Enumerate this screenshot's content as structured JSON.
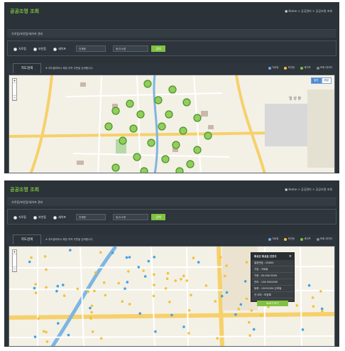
{
  "screen1": {
    "title": "공공조명 조회",
    "breadcrumb": "Home > 공공관리 > 공공조명 조회",
    "section_label": "가로등/보안등/세이프 관리",
    "radios": [
      "가로등",
      "보안등",
      "세이프"
    ],
    "select_value": "전체행",
    "search_placeholder": "동/주소명",
    "search_button": "검색",
    "map_tab": "지도검색",
    "map_hint": "※ 지도클릭하시 해당 지역 주변설 검색합니다.",
    "legend": [
      "가로등",
      "보안등",
      "세이프",
      "조회 데이터"
    ],
    "map_toggle": [
      "일반",
      "위성"
    ],
    "map_place": "일 성 정"
  },
  "screen2": {
    "title": "공공조명 조회",
    "breadcrumb": "Home > 공공관리 > 공공조명 조회",
    "section_label": "가로등/보안등/세이프 관리",
    "radios": [
      "가로등",
      "보안등",
      "세이프"
    ],
    "select_value": "전체행",
    "search_placeholder": "동/주소명",
    "search_button": "검색",
    "map_tab": "지도검색",
    "map_hint": "※ 지도클릭하시 해당 지역 주변설 검색합니다.",
    "legend": [
      "가로등",
      "보안등",
      "세이프",
      "조회 데이터"
    ],
    "popup": {
      "title": "화성군 화성읍 안전지",
      "rows": [
        "일련번호 : 00000",
        "구분 : 가로등",
        "기준 : 00.000.0000",
        "관리 : 126.5000000",
        "등록 : 12031300 군포동",
        "관 리자 : 미등록"
      ],
      "button": "바로가 보기"
    }
  },
  "colors": {
    "accent": "#7fc241",
    "bg": "#2b3238",
    "streetlight": "#6aa7e8",
    "security": "#f2c23a",
    "safe": "#7fc241",
    "query": "#888888"
  }
}
